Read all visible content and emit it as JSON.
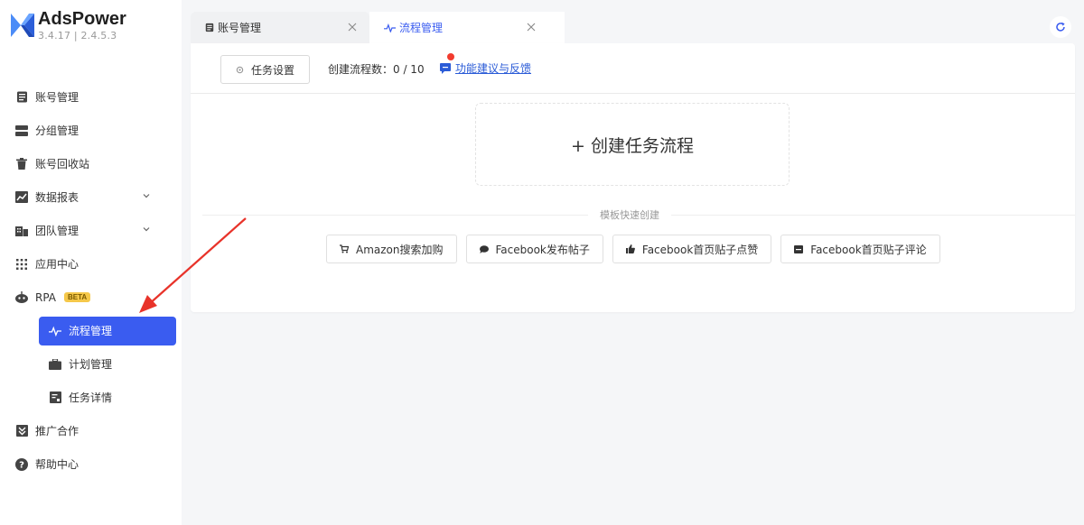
{
  "app": {
    "name": "AdsPower",
    "version": "3.4.17 | 2.4.5.3"
  },
  "sidebar": {
    "items": [
      {
        "label": "账号管理",
        "icon": "account-list-icon"
      },
      {
        "label": "分组管理",
        "icon": "group-icon"
      },
      {
        "label": "账号回收站",
        "icon": "trash-icon"
      },
      {
        "label": "数据报表",
        "icon": "chart-icon",
        "expandable": true
      },
      {
        "label": "团队管理",
        "icon": "team-icon",
        "expandable": true
      },
      {
        "label": "应用中心",
        "icon": "apps-grid-icon"
      },
      {
        "label": "RPA",
        "icon": "robot-icon",
        "badge": "BETA",
        "expanded": true
      }
    ],
    "rpa_children": [
      {
        "label": "流程管理",
        "icon": "pulse-icon",
        "active": true
      },
      {
        "label": "计划管理",
        "icon": "briefcase-icon"
      },
      {
        "label": "任务详情",
        "icon": "task-detail-icon"
      }
    ],
    "bottom_items": [
      {
        "label": "推广合作",
        "icon": "partnership-icon"
      },
      {
        "label": "帮助中心",
        "icon": "help-icon"
      }
    ]
  },
  "tabs": [
    {
      "label": "账号管理",
      "icon": "account-list-icon",
      "active": false
    },
    {
      "label": "流程管理",
      "icon": "pulse-icon",
      "active": true
    }
  ],
  "toolbar": {
    "settings_label": "任务设置",
    "count_label": "创建流程数：0 / 10",
    "feedback_label": "功能建议与反馈"
  },
  "main": {
    "create_label": "+ 创建任务流程",
    "template_section_label": "模板快速创建",
    "templates": [
      {
        "label": "Amazon搜索加购",
        "icon": "cart-icon"
      },
      {
        "label": "Facebook发布帖子",
        "icon": "chat-bubble-icon"
      },
      {
        "label": "Facebook首页贴子点赞",
        "icon": "thumbs-up-icon"
      },
      {
        "label": "Facebook首页贴子评论",
        "icon": "comment-icon"
      }
    ]
  },
  "colors": {
    "accent": "#3a5cf0",
    "beta_badge": "#f5c84a",
    "annotation_arrow": "#e8332a",
    "notification_dot": "#f23b2e"
  }
}
